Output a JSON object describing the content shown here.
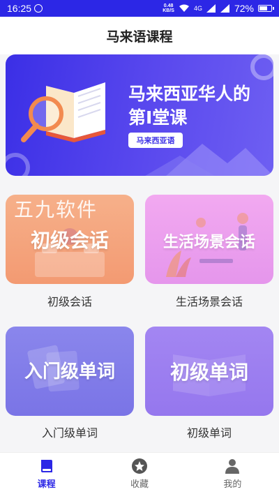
{
  "status": {
    "time": "16:25",
    "net_speed_top": "0.48",
    "net_speed_bottom": "KB/S",
    "signal_1": "4G",
    "battery": "72%",
    "battery_level": 0.72
  },
  "app_bar": {
    "title": "马来语课程"
  },
  "banner": {
    "line1": "马来西亚华人的",
    "line2": "第I堂课",
    "tag": "马来西亚语"
  },
  "watermark": "五九软件",
  "cards": [
    {
      "image_text": "初级会话",
      "label": "初级会话"
    },
    {
      "image_text": "生活场景会话",
      "label": "生活场景会话"
    },
    {
      "image_text": "入门级单词",
      "label": "入门级单词"
    },
    {
      "image_text": "初级单词",
      "label": "初级单词"
    }
  ],
  "nav": [
    {
      "label": "课程",
      "icon": "book-icon",
      "active": true
    },
    {
      "label": "收藏",
      "icon": "star-icon",
      "active": false
    },
    {
      "label": "我的",
      "icon": "person-icon",
      "active": false
    }
  ],
  "colors": {
    "primary": "#2c27e6",
    "card1": "#f39a72",
    "card2": "#e596ec",
    "card3": "#7a74e6",
    "card4": "#9577ee"
  }
}
